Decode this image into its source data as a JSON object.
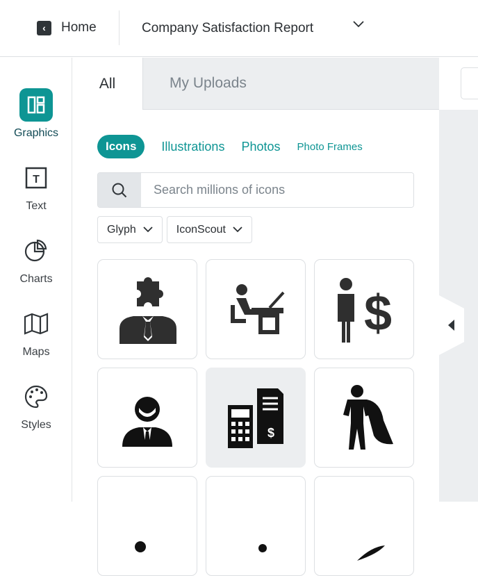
{
  "topbar": {
    "home_label": "Home",
    "doc_title": "Company Satisfaction Report"
  },
  "nav": [
    {
      "label": "Graphics"
    },
    {
      "label": "Text"
    },
    {
      "label": "Charts"
    },
    {
      "label": "Maps"
    },
    {
      "label": "Styles"
    }
  ],
  "tabs": {
    "all": "All",
    "uploads": "My Uploads"
  },
  "categories": [
    "Icons",
    "Illustrations",
    "Photos",
    "Photo Frames"
  ],
  "search": {
    "placeholder": "Search millions of icons"
  },
  "filters": {
    "style": "Glyph",
    "source": "IconScout"
  },
  "accent": "#0e9594"
}
